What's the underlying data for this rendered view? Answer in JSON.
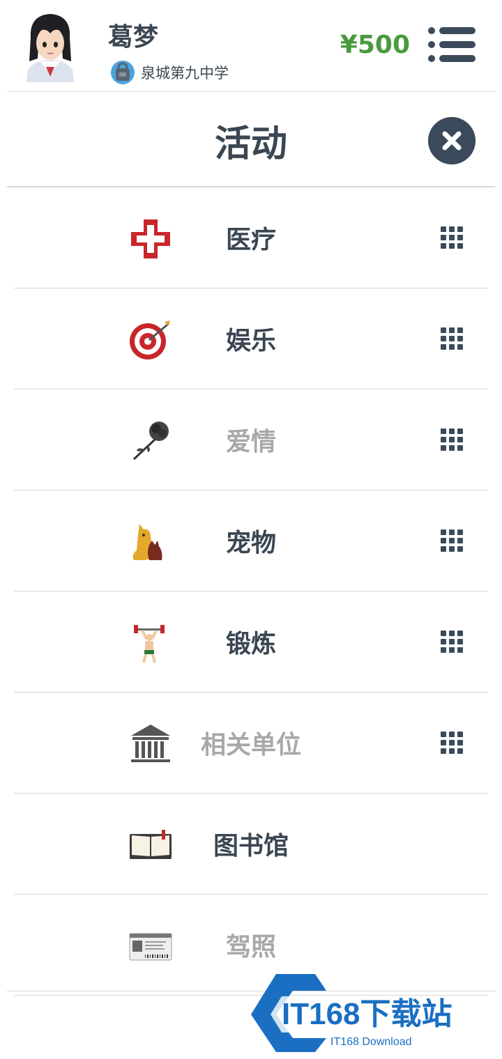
{
  "header": {
    "user_name": "葛梦",
    "school": "泉城第九中学",
    "money": "¥500"
  },
  "title": "活动",
  "items": [
    {
      "label": "医疗",
      "icon": "red-cross-icon",
      "enabled": true,
      "has_grid": true
    },
    {
      "label": "娱乐",
      "icon": "dart-target-icon",
      "enabled": true,
      "has_grid": true
    },
    {
      "label": "爱情",
      "icon": "rose-icon",
      "enabled": false,
      "has_grid": true
    },
    {
      "label": "宠物",
      "icon": "pets-icon",
      "enabled": true,
      "has_grid": true
    },
    {
      "label": "锻炼",
      "icon": "weightlifter-icon",
      "enabled": true,
      "has_grid": true
    },
    {
      "label": "相关单位",
      "icon": "institution-building-icon",
      "enabled": false,
      "has_grid": true
    },
    {
      "label": "图书馆",
      "icon": "open-book-icon",
      "enabled": true,
      "has_grid": false
    },
    {
      "label": "驾照",
      "icon": "driver-license-icon",
      "enabled": false,
      "has_grid": false
    }
  ],
  "watermark": {
    "brand": "IT168下载站",
    "sub": "IT168 Download"
  },
  "colors": {
    "money": "#4a9a3f",
    "primary_text": "#3a4652",
    "disabled_text": "#a8a8a8",
    "close_button": "#3b4a5b"
  }
}
